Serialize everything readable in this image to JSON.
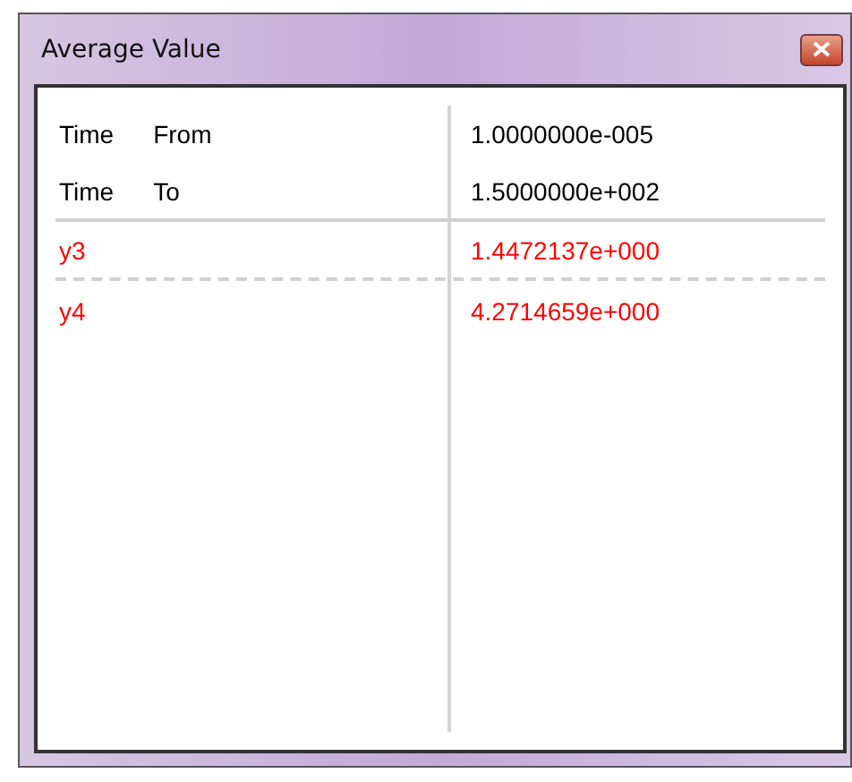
{
  "window": {
    "title": "Average Value"
  },
  "rows": [
    {
      "kind": "time",
      "label": "Time",
      "sublabel": "From",
      "value": "1.0000000e-005",
      "color": "#000000"
    },
    {
      "kind": "time",
      "label": "Time",
      "sublabel": "To",
      "value": "1.5000000e+002",
      "color": "#000000"
    },
    {
      "kind": "series",
      "label": "y3",
      "value": "1.4472137e+000",
      "color": "#ff0000"
    },
    {
      "kind": "series",
      "label": "y4",
      "value": "4.2714659e+000",
      "color": "#ff0000"
    }
  ]
}
